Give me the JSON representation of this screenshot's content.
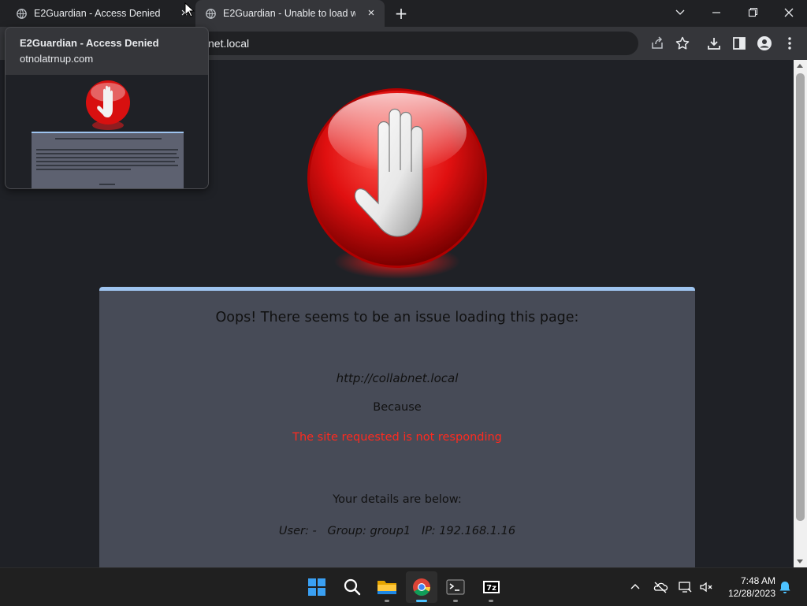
{
  "browser": {
    "tabs": [
      {
        "title": "E2Guardian - Access Denied",
        "active": false
      },
      {
        "title": "E2Guardian - Unable to load we",
        "active": true
      }
    ],
    "address_bar": {
      "url": "net.local"
    },
    "colors": {
      "tab_strip": "#202124",
      "toolbar": "#35363a",
      "page_bg": "#1f2126"
    }
  },
  "hover_card": {
    "title": "E2Guardian - Access Denied",
    "domain": "otnolatrnup.com"
  },
  "page": {
    "icon": "stop-hand-icon",
    "heading": "Oops! There seems to be an issue loading this page:",
    "url": "http://collabnet.local",
    "because_label": "Because",
    "reason": "The site requested is not responding",
    "details_heading": "Your details are below:",
    "user_line": "User: -   Group: group1   IP: 192.168.1.16",
    "colors": {
      "panel": "#474b57",
      "panel_border": "#9ec4ef",
      "reason": "#ff2a1f"
    }
  },
  "taskbar": {
    "apps": [
      "start-icon",
      "search-icon",
      "file-explorer-icon",
      "chrome-icon",
      "terminal-icon",
      "7zip-icon"
    ],
    "active_app": "chrome-icon",
    "time": "7:48 AM",
    "date": "12/28/2023"
  }
}
